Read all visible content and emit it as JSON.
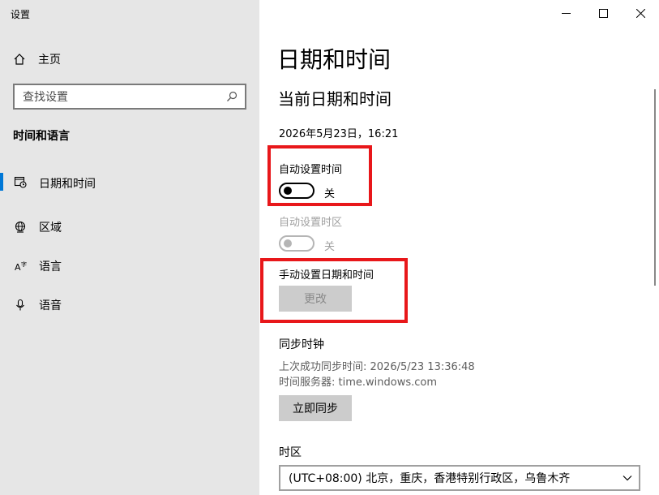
{
  "app": {
    "title": "设置"
  },
  "sidebar": {
    "home_label": "主页",
    "search_placeholder": "查找设置",
    "section_heading": "时间和语言",
    "items": [
      {
        "label": "日期和时间",
        "icon": "calendar-clock-icon",
        "selected": true
      },
      {
        "label": "区域",
        "icon": "globe-icon",
        "selected": false
      },
      {
        "label": "语言",
        "icon": "language-icon",
        "selected": false
      },
      {
        "label": "语音",
        "icon": "microphone-icon",
        "selected": false
      }
    ]
  },
  "main": {
    "page_title": "日期和时间",
    "sub_title": "当前日期和时间",
    "current_datetime": "2026年5月23日，16:21",
    "auto_time": {
      "label": "自动设置时间",
      "state": "关",
      "on": false
    },
    "auto_timezone": {
      "label": "自动设置时区",
      "state": "关",
      "on": false,
      "disabled": true
    },
    "manual": {
      "label": "手动设置日期和时间",
      "button": "更改"
    },
    "sync": {
      "heading": "同步时钟",
      "last_sync": "上次成功同步时间: 2026/5/23 13:36:48",
      "server": "时间服务器: time.windows.com",
      "button": "立即同步"
    },
    "timezone": {
      "heading": "时区",
      "value": "(UTC+08:00) 北京，重庆，香港特别行政区，乌鲁木齐"
    }
  },
  "colors": {
    "accent": "#0078d7",
    "highlight": "#e8171a",
    "sidebar_bg": "#e6e6e6"
  }
}
